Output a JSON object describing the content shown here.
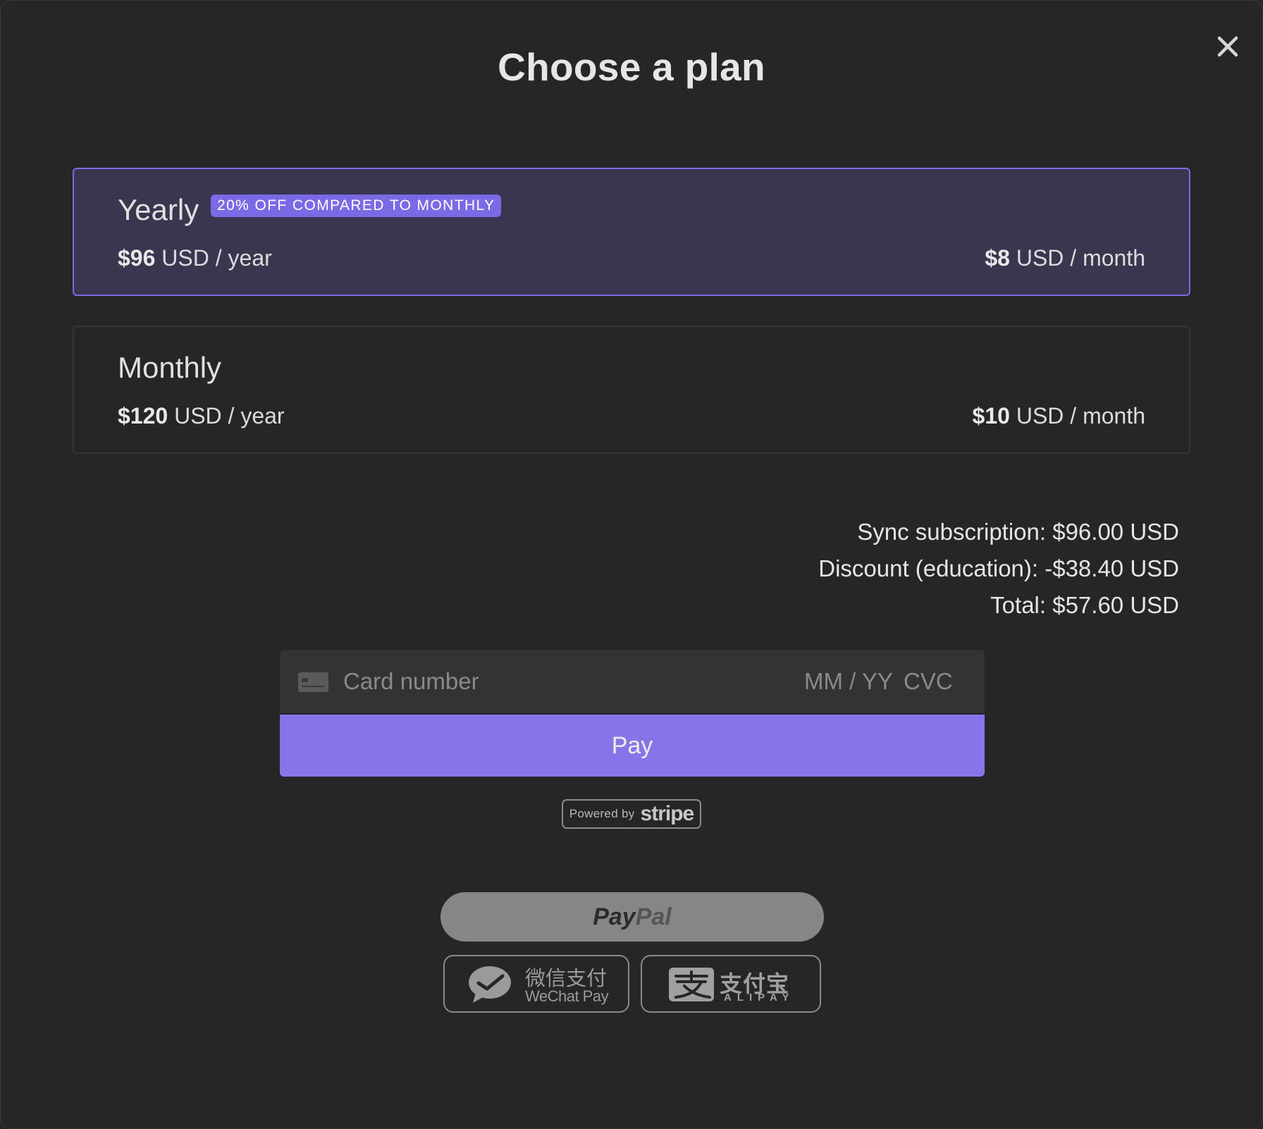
{
  "dialog": {
    "title": "Choose a plan",
    "close_icon": "close-icon"
  },
  "plans": [
    {
      "name": "Yearly",
      "badge": "20% OFF COMPARED TO MONTHLY",
      "year_amount": "$96",
      "year_suffix": " USD / year",
      "month_amount": "$8",
      "month_suffix": " USD / month",
      "selected": true
    },
    {
      "name": "Monthly",
      "year_amount": "$120",
      "year_suffix": " USD / year",
      "month_amount": "$10",
      "month_suffix": " USD / month",
      "selected": false
    }
  ],
  "summary": {
    "subscription": "Sync subscription: $96.00 USD",
    "discount": "Discount (education): -$38.40 USD",
    "total": "Total: $57.60 USD"
  },
  "card": {
    "icon": "credit-card-icon",
    "number_placeholder": "Card number",
    "number_value": "",
    "expiry_placeholder": "MM / YY",
    "expiry_value": "",
    "cvc_placeholder": "CVC",
    "cvc_value": ""
  },
  "pay_button": {
    "label": "Pay"
  },
  "stripe": {
    "powered_by": "Powered by",
    "brand": "stripe"
  },
  "alt_payments": {
    "paypal_part1": "Pay",
    "paypal_part2": "Pal",
    "wechat_cn": "微信支付",
    "wechat_en": "WeChat Pay",
    "alipay_cn": "支付宝",
    "alipay_en": "ALIPAY"
  },
  "colors": {
    "background": "#262626",
    "accent": "#7a6ae6",
    "pay_button": "#8675e8",
    "selected_plan_bg": "#3b364f"
  }
}
